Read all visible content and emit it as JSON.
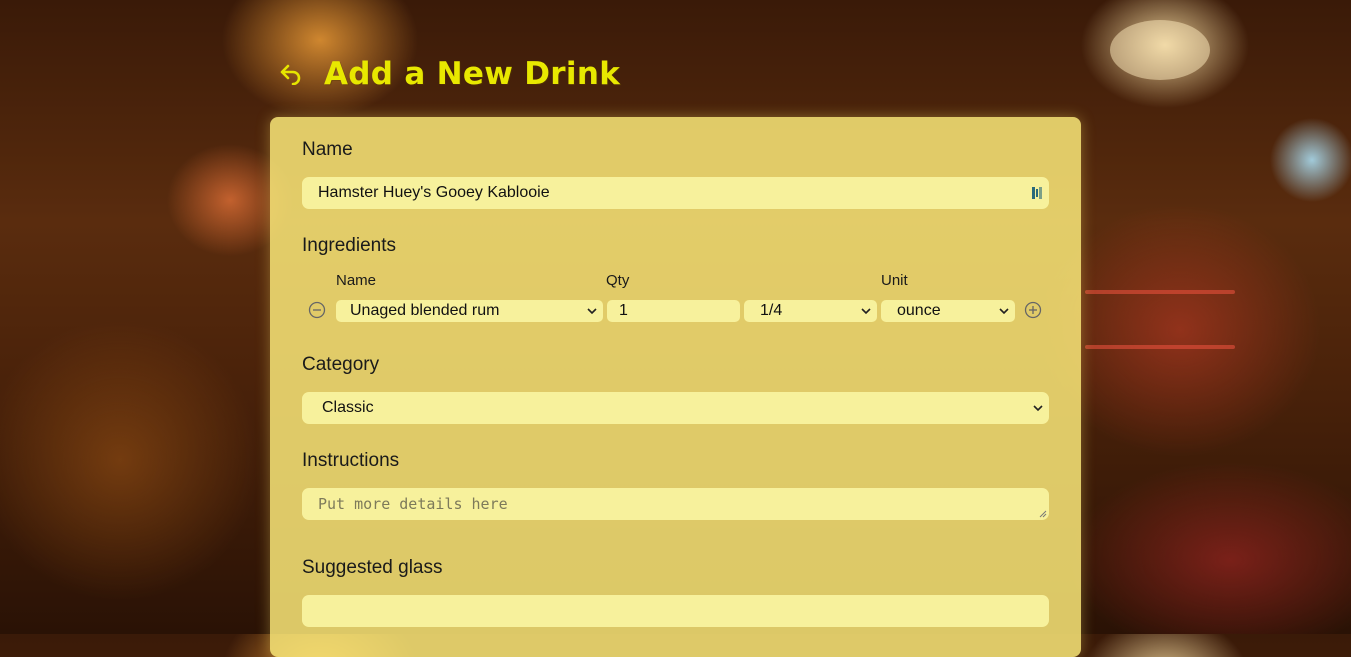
{
  "header": {
    "title": "Add a New Drink"
  },
  "form": {
    "name_label": "Name",
    "name_value": "Hamster Huey's Gooey Kablooie",
    "ingredients_label": "Ingredients",
    "ingredient_columns": {
      "name": "Name",
      "qty": "Qty",
      "unit": "Unit"
    },
    "ingredient_row": {
      "name": "Unaged blended rum",
      "qty_whole": "1",
      "qty_fraction": "1/4",
      "unit": "ounce"
    },
    "category_label": "Category",
    "category_value": "Classic",
    "instructions_label": "Instructions",
    "instructions_placeholder": "Put more details here",
    "glass_label": "Suggested glass",
    "glass_value": ""
  },
  "colors": {
    "title": "#e8e800",
    "panel": "#f9e678",
    "field": "#f7f19c"
  }
}
